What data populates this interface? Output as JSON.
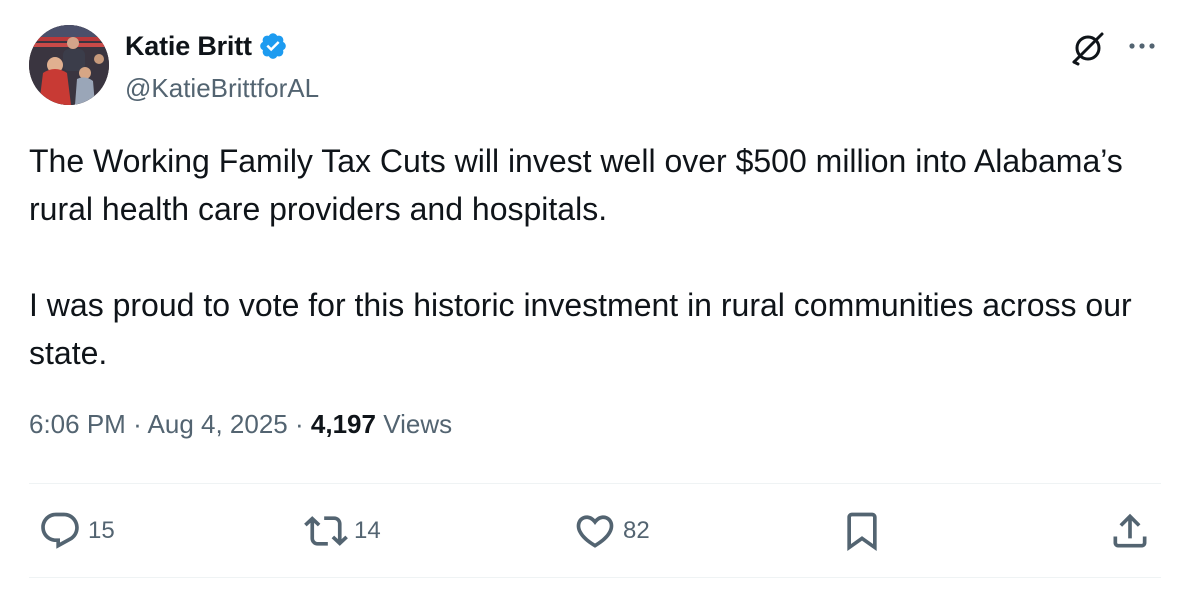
{
  "author": {
    "display_name": "Katie Britt",
    "handle": "@KatieBrittforAL",
    "verified_icon": "verified-badge-icon"
  },
  "header_icons": [
    "grok-icon",
    "more-icon"
  ],
  "tweet": {
    "paragraphs": [
      "The Working Family Tax Cuts will invest well over $500 million into Alabama’s rural health care providers and hospitals.",
      "I was proud to vote for this historic investment in rural communities across our state."
    ]
  },
  "meta": {
    "time": "6:06 PM",
    "separator": "·",
    "date": "Aug 4, 2025",
    "views_count": "4,197",
    "views_label": "Views"
  },
  "actions": {
    "reply": {
      "icon": "reply-icon",
      "count": "15"
    },
    "retweet": {
      "icon": "retweet-icon",
      "count": "14"
    },
    "like": {
      "icon": "heart-icon",
      "count": "82"
    },
    "bookmark": {
      "icon": "bookmark-icon"
    },
    "share": {
      "icon": "share-icon"
    }
  },
  "colors": {
    "text": "#0f1419",
    "secondary": "#536471",
    "verified": "#1d9bf0",
    "divider": "#eff3f4"
  }
}
